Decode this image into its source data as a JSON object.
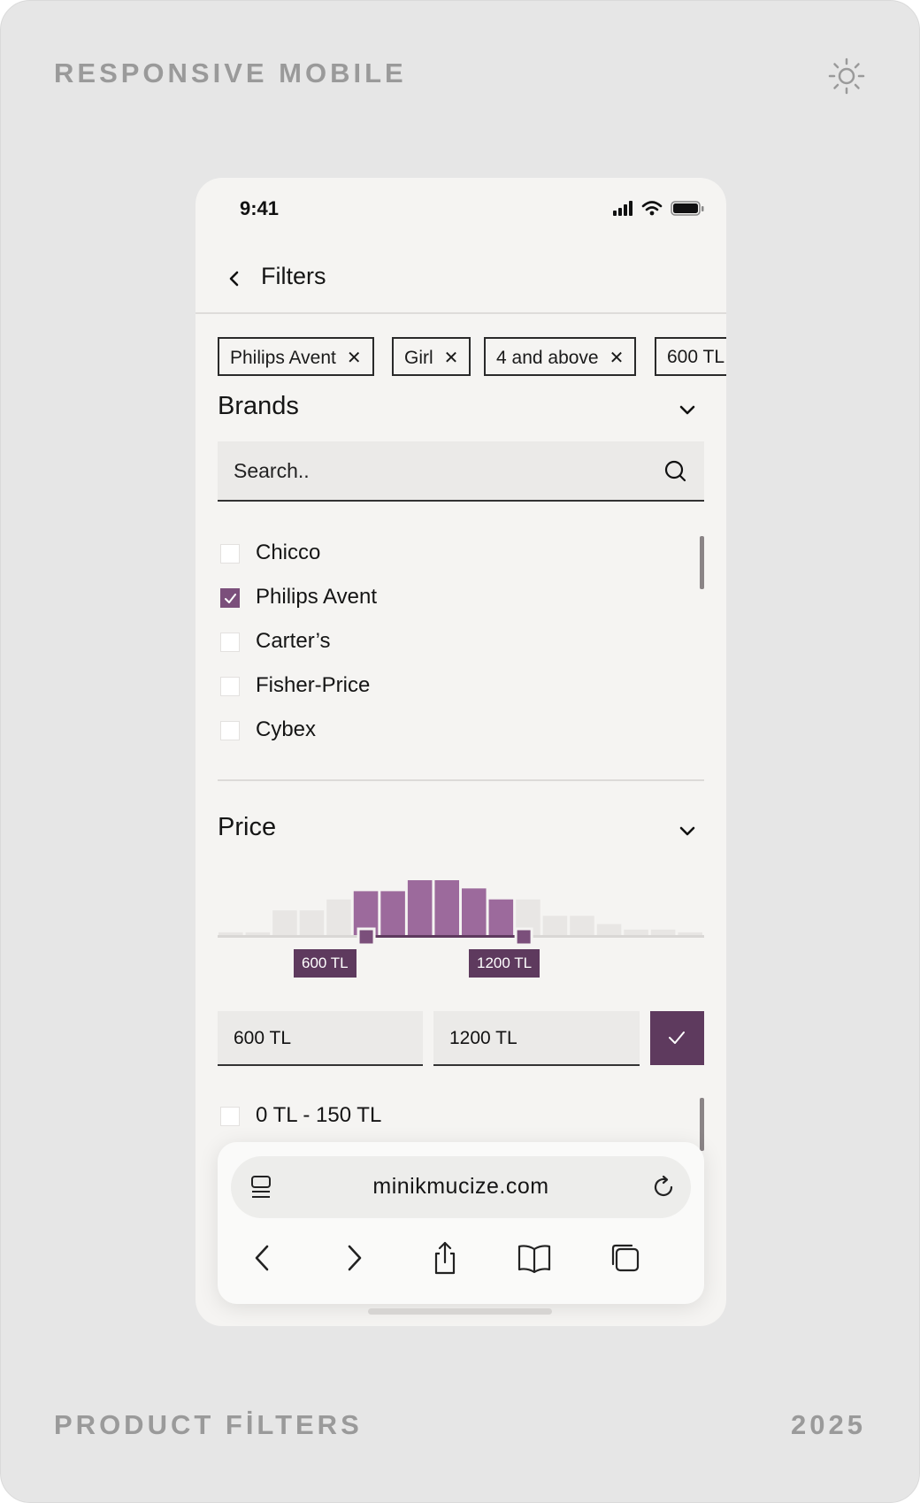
{
  "header": {
    "label": "RESPONSIVE MOBILE",
    "theme_icon": "sun-icon"
  },
  "footer": {
    "left": "PRODUCT FİLTERS",
    "right": "2025"
  },
  "status_bar": {
    "time": "9:41"
  },
  "nav": {
    "title": "Filters",
    "back_icon": "chevron-left-icon"
  },
  "chips": [
    {
      "label": "Philips Avent",
      "remove": "✕"
    },
    {
      "label": "Girl",
      "remove": "✕"
    },
    {
      "label": "4 and above",
      "remove": "✕"
    },
    {
      "label": "600 TL",
      "remove": ""
    }
  ],
  "brands": {
    "title": "Brands",
    "search_placeholder": "Search..",
    "items": [
      {
        "label": "Chicco",
        "checked": false
      },
      {
        "label": "Philips Avent",
        "checked": true
      },
      {
        "label": "Carter’s",
        "checked": false
      },
      {
        "label": "Fisher-Price",
        "checked": false
      },
      {
        "label": "Cybex",
        "checked": false
      }
    ]
  },
  "price": {
    "title": "Price",
    "min_tag": "600 TL",
    "max_tag": "1200 TL",
    "min_value": "600 TL",
    "max_value": "1200 TL",
    "histogram_levels": [
      0.05,
      0.05,
      0.45,
      0.45,
      0.65,
      0.8,
      0.8,
      1.0,
      1.0,
      0.85,
      0.65,
      0.65,
      0.35,
      0.35,
      0.2,
      0.1,
      0.1,
      0.05
    ],
    "selected_range_bins": [
      5,
      10
    ],
    "ranges": [
      {
        "label": "0 TL - 150 TL",
        "checked": false
      }
    ]
  },
  "browser": {
    "url": "minikmucize.com"
  },
  "colors": {
    "accent": "#7b4f7b",
    "accent_dark": "#5e3a5e",
    "hist_inactive": "#e8e6e4",
    "hist_active": "#9c6a9c"
  }
}
